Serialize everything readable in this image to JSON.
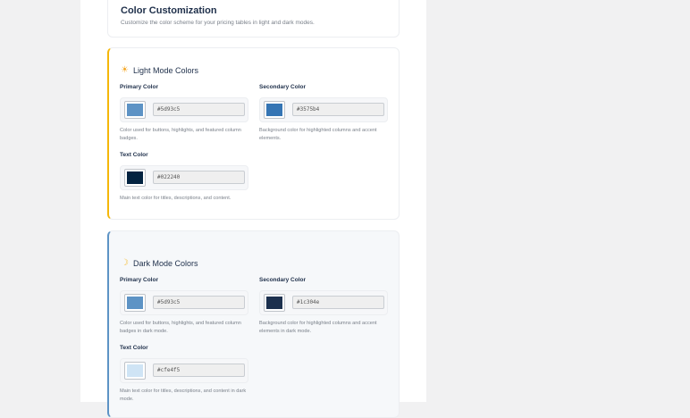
{
  "header": {
    "title": "Color Customization",
    "subtitle": "Customize the color scheme for your pricing tables in light and dark modes."
  },
  "light": {
    "title": "Light Mode Colors",
    "icon": "sun-icon",
    "primary": {
      "label": "Primary Color",
      "value": "#5d93c5",
      "help": "Color used for buttons, highlights, and featured column badges."
    },
    "secondary": {
      "label": "Secondary Color",
      "value": "#3575b4",
      "help": "Background color for highlighted columns and accent elements."
    },
    "text": {
      "label": "Text Color",
      "value": "#022240",
      "help": "Main text color for titles, descriptions, and content."
    }
  },
  "dark": {
    "title": "Dark Mode Colors",
    "icon": "moon-icon",
    "primary": {
      "label": "Primary Color",
      "value": "#5d93c5",
      "help": "Color used for buttons, highlights, and featured column badges in dark mode."
    },
    "secondary": {
      "label": "Secondary Color",
      "value": "#1c304e",
      "help": "Background color for highlighted columns and accent elements in dark mode."
    },
    "text": {
      "label": "Text Color",
      "value": "#cfe4f5",
      "help": "Main text color for titles, descriptions, and content in dark mode."
    }
  }
}
